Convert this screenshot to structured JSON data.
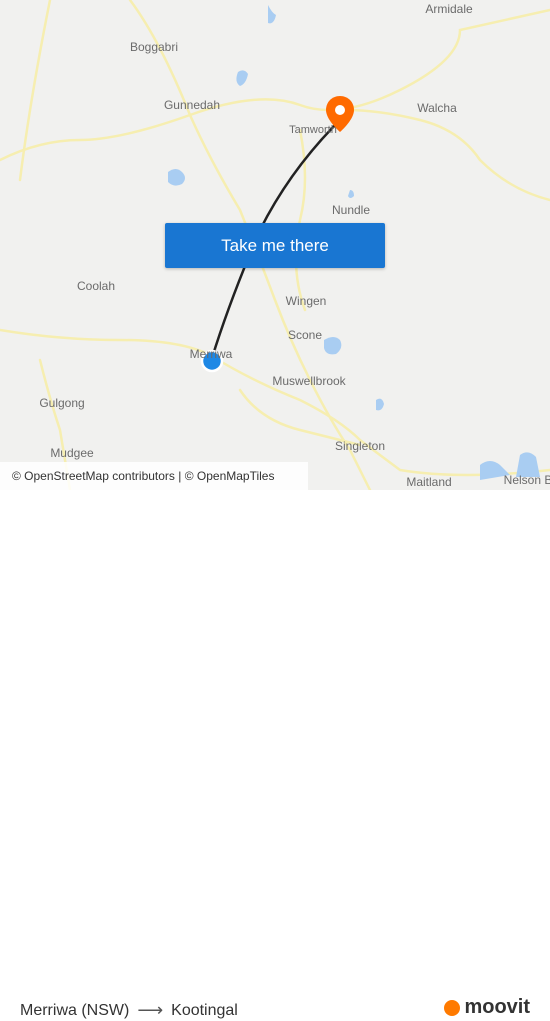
{
  "map": {
    "places": [
      {
        "id": "armidale",
        "label": "Armidale"
      },
      {
        "id": "boggabri",
        "label": "Boggabri"
      },
      {
        "id": "gunnedah",
        "label": "Gunnedah"
      },
      {
        "id": "tamworth",
        "label": "Tamworth"
      },
      {
        "id": "walcha",
        "label": "Walcha"
      },
      {
        "id": "nundle",
        "label": "Nundle"
      },
      {
        "id": "coolah",
        "label": "Coolah"
      },
      {
        "id": "wingen",
        "label": "Wingen"
      },
      {
        "id": "scone",
        "label": "Scone"
      },
      {
        "id": "merriwa",
        "label": "Merriwa"
      },
      {
        "id": "muswellbrook",
        "label": "Muswellbrook"
      },
      {
        "id": "gulgong",
        "label": "Gulgong"
      },
      {
        "id": "singleton",
        "label": "Singleton"
      },
      {
        "id": "mudgee",
        "label": "Mudgee"
      },
      {
        "id": "maitland",
        "label": "Maitland"
      },
      {
        "id": "nelson-bay",
        "label": "Nelson B"
      }
    ],
    "cta_label": "Take me there",
    "attribution": "© OpenStreetMap contributors | © OpenMapTiles",
    "colors": {
      "route": "#222222",
      "destination_pin": "#ff6a00",
      "origin_dot": "#1e88e5",
      "water": "#a9cdf2",
      "roads": "#f7efb0",
      "button": "#1976d2"
    }
  },
  "footer": {
    "origin": "Merriwa (NSW)",
    "arrow": "⟶",
    "destination": "Kootingal",
    "brand": "moovit"
  }
}
